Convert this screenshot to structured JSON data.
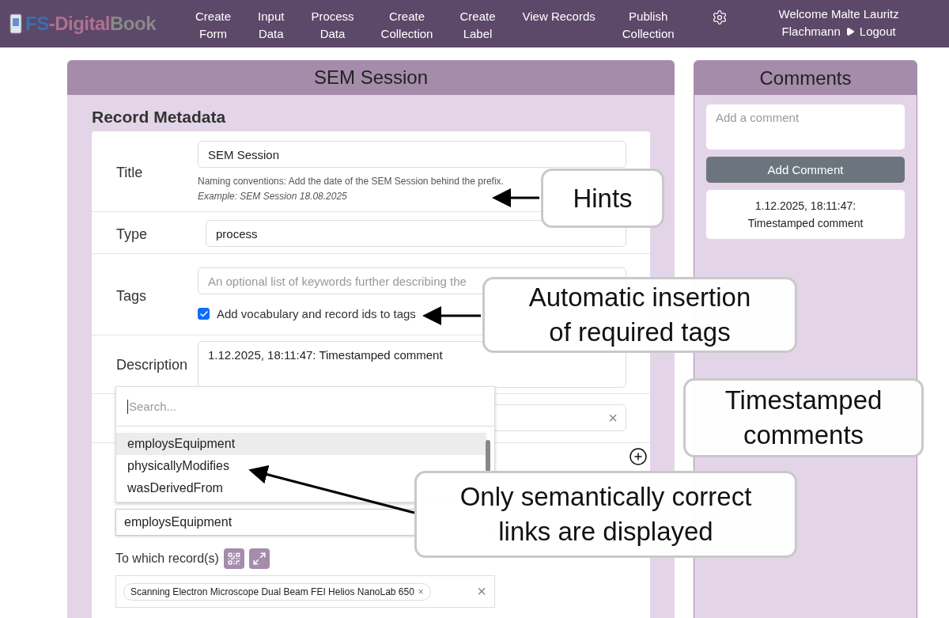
{
  "navbar": {
    "logo": [
      {
        "text": "FS",
        "color": "#3b6fb0"
      },
      {
        "text": "-Digital",
        "color": "#b0708f"
      },
      {
        "text": "Book",
        "color": "#8a8a8a"
      }
    ],
    "items": [
      "Create\nForm",
      "Input\nData",
      "Process\nData",
      "Create\nCollection",
      "Create\nLabel",
      "View Records",
      "Publish\nCollection"
    ],
    "user": {
      "welcome": "Welcome Malte Lauritz",
      "name": "Flachmann",
      "logout": "Logout"
    }
  },
  "record": {
    "title": "SEM Session",
    "section": "Record Metadata",
    "fields": [
      {
        "kind": "hinted",
        "label": "Title",
        "value": "SEM Session",
        "hint": "Naming conventions: Add the date of the SEM Session behind the prefix.",
        "example": "Example: SEM Session 18.08.2025"
      },
      {
        "kind": "text",
        "label": "Type",
        "value": "process"
      },
      {
        "kind": "tags",
        "label": "Tags",
        "placeholder": "An optional list of keywords further describing the",
        "checkbox": {
          "label": "Add vocabulary and record ids to tags",
          "checked": true
        }
      },
      {
        "kind": "textarea",
        "label": "Description",
        "value": "1.12.2025, 18:11:47: Timestamped comment"
      },
      {
        "kind": "clearable",
        "clear": "×"
      }
    ],
    "link": {
      "relation": "employsEquipment",
      "records_label": "To which record(s)",
      "chip": "Scanning Electron Microscope Dual Beam FEI Helios NanoLab 650",
      "chip_remove": "×",
      "clear": "×"
    },
    "dropdown": {
      "placeholder": "Search...",
      "options": [
        {
          "label": "employsEquipment",
          "selected": true
        },
        {
          "label": "physicallyModifies",
          "selected": false
        },
        {
          "label": "wasDerivedFrom",
          "selected": false
        }
      ]
    }
  },
  "comments": {
    "title": "Comments",
    "placeholder": "Add a comment",
    "button": "Add Comment",
    "items": [
      "1.12.2025, 18:11:47:\nTimestamped comment"
    ]
  },
  "annotations": [
    "Hints",
    "Automatic insertion\nof required tags",
    "Timestamped\ncomments",
    "Only semantically correct\nlinks are displayed"
  ]
}
